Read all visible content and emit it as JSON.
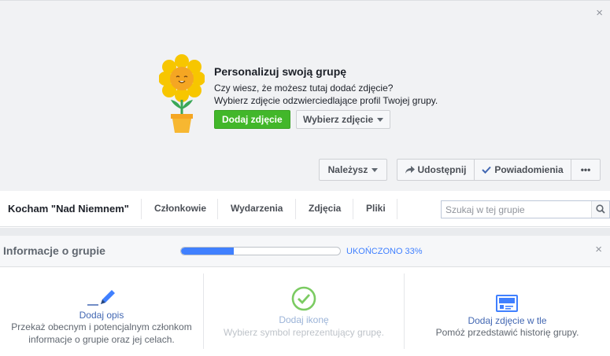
{
  "cover": {
    "title": "Personalizuj swoją grupę",
    "line1": "Czy wiesz, że możesz tutaj dodać zdjęcie?",
    "line2": "Wybierz zdjęcie odzwierciedlające profil Twojej grupy.",
    "add_photo_label": "Dodaj zdjęcie",
    "choose_photo_label": "Wybierz zdjęcie",
    "close_icon": "×"
  },
  "actions": {
    "member_label": "Należysz",
    "share_label": "Udostępnij",
    "notifications_label": "Powiadomienia",
    "more_label": "•••"
  },
  "nav": {
    "group_name": "Kocham \"Nad Niemnem\"",
    "tabs": [
      "Członkowie",
      "Wydarzenia",
      "Zdjęcia",
      "Pliki"
    ],
    "search_placeholder": "Szukaj w tej grupie"
  },
  "info": {
    "title": "Informacje o grupie",
    "progress_percent": 33,
    "progress_label": "UKOŃCZONO 33%",
    "close_icon": "×",
    "cards": [
      {
        "link": "Dodaj opis",
        "desc1": "Przekaż obecnym i potencjalnym członkom",
        "desc2": "informacje o grupie oraz jej celach.",
        "icon": "pencil-icon",
        "enabled": true
      },
      {
        "link": "Dodaj ikonę",
        "desc1": "Wybierz symbol reprezentujący grupę.",
        "desc2": "",
        "icon": "check-circle-icon",
        "enabled": false
      },
      {
        "link": "Dodaj zdjęcie w tle",
        "desc1": "Pomóż przedstawić historię grupy.",
        "desc2": "",
        "icon": "photo-icon",
        "enabled": true
      }
    ]
  },
  "colors": {
    "accent": "#4267b2",
    "green": "#42b72a",
    "progress": "#4080ff",
    "check": "#7bcb62"
  }
}
